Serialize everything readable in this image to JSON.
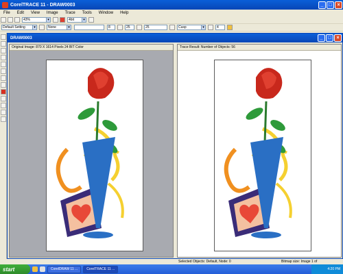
{
  "window": {
    "title": "CorelTRACE 11 - DRAW0003"
  },
  "menu": [
    "File",
    "Edit",
    "View",
    "Image",
    "Trace",
    "Tools",
    "Window",
    "Help"
  ],
  "toolbar1": {
    "zoom_value": "43%",
    "color_value": "4bit"
  },
  "toolbar2": {
    "preset_value": "Default Setting",
    "node_type_value": "Cusp",
    "curve_value": "None",
    "smooth_value": "25",
    "noise_value": "8",
    "accuracy_value": "25",
    "width_value": "4"
  },
  "document": {
    "title": "DRAW0003",
    "left_pane_header": "Original Image: 870 X 1614 Pixels 24 BIT Color",
    "right_pane_header": "Trace Result: Number of Objects: 56"
  },
  "status": {
    "selection": "Selected Objects: Default, Node: 0",
    "info": "Bitmap size: Image 1 of"
  },
  "taskbar": {
    "start_label": "start",
    "tasks": [
      "CorelDRAW 11 ...",
      "CorelTRACE 11 ..."
    ],
    "clock": "4:20 PM"
  },
  "colors": {
    "rose": "#c8281c",
    "leaf": "#2e9a3a",
    "vase": "#2a6fc4",
    "ribbon_yellow": "#f5d030",
    "ribbon_orange": "#f09020",
    "card": "#3a2c78",
    "heart": "#e84838"
  }
}
